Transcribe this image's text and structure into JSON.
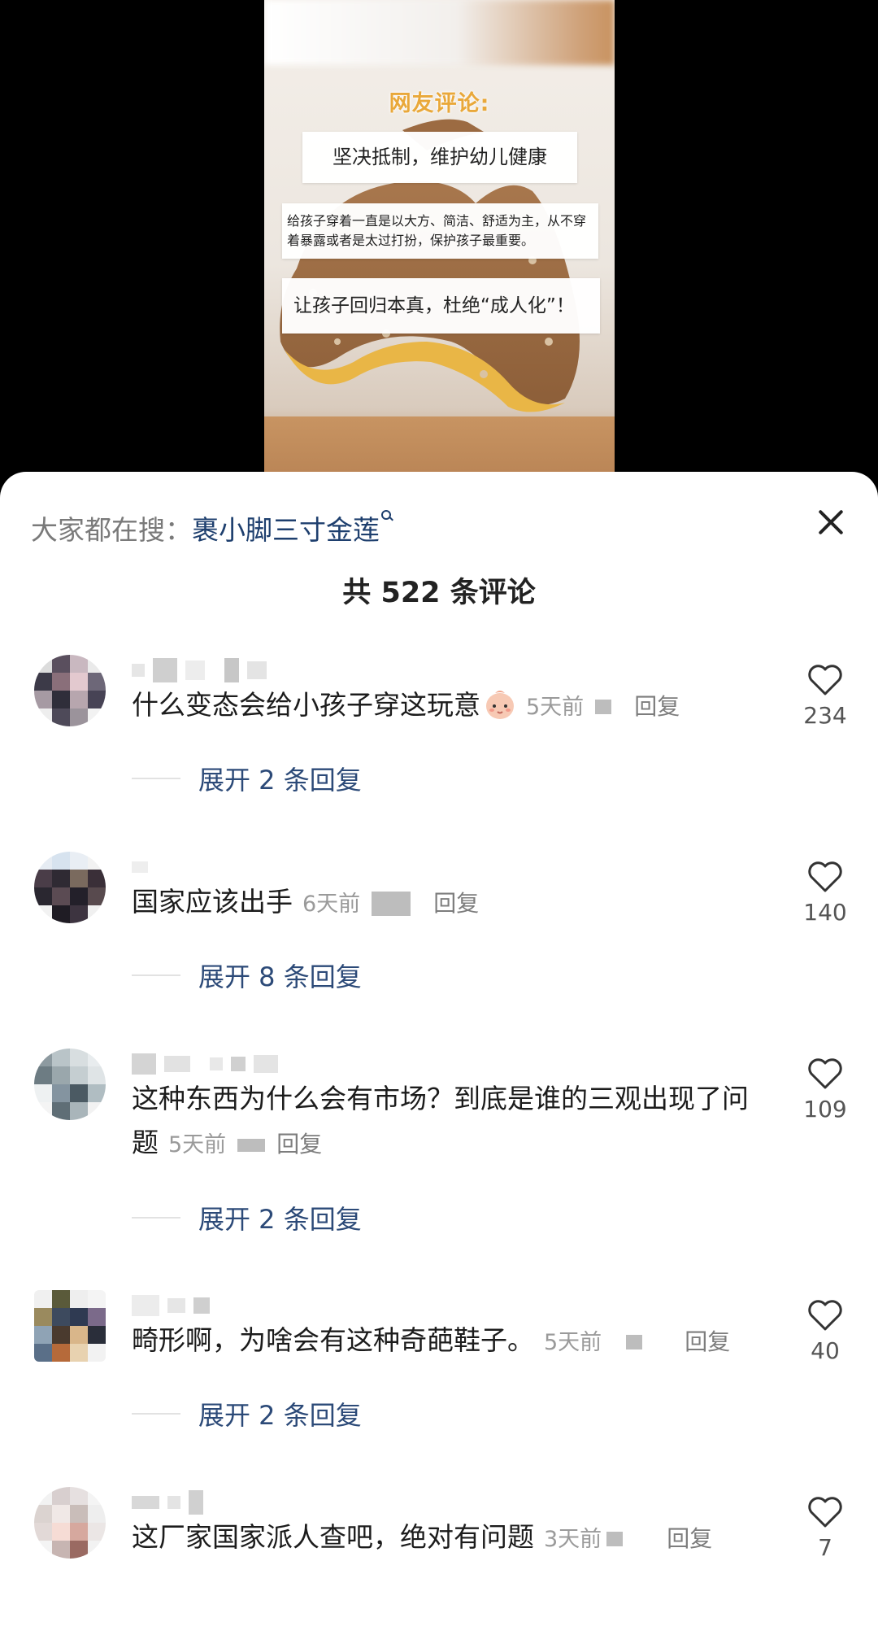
{
  "video": {
    "title": "网友评论:",
    "box1": "坚决抵制，维护幼儿健康",
    "box2": "给孩子穿着一直是以大方、简洁、舒适为主，从不穿着暴露或者是太过打扮，保护孩子最重要。",
    "box3": "让孩子回归本真，杜绝“成人化”！"
  },
  "search": {
    "prefix": "大家都在搜：",
    "keyword": "裹小脚三寸金莲"
  },
  "comments_title": "共 522 条评论",
  "comments": [
    {
      "text": "什么变态会给小孩子穿这玩意",
      "time": "5天前",
      "reply": "回复",
      "likes": "234",
      "expand": "展开 2 条回复"
    },
    {
      "text": "国家应该出手",
      "time": "6天前",
      "reply": "回复",
      "likes": "140",
      "expand": "展开 8 条回复"
    },
    {
      "text": "这种东西为什么会有市场？到底是谁的三观出现了问题",
      "time": "5天前",
      "reply": "回复",
      "likes": "109",
      "expand": "展开 2 条回复"
    },
    {
      "text": "畸形啊，为啥会有这种奇葩鞋子。",
      "time": "5天前",
      "reply": "回复",
      "likes": "40",
      "expand": "展开 2 条回复"
    },
    {
      "text": "这厂家国家派人查吧，绝对有问题",
      "time": "3天前",
      "reply": "回复",
      "likes": "7",
      "expand": ""
    }
  ],
  "icons": {
    "close": "close-icon",
    "like": "heart-outline-icon",
    "search_hint": "search-hint-icon",
    "emoji": "baby-face-emoji-icon"
  },
  "colors": {
    "keyword": "#1e3f6e",
    "expand_link": "#2c4a78",
    "meta": "#9a9a9a",
    "video_title": "#e9a83a"
  }
}
